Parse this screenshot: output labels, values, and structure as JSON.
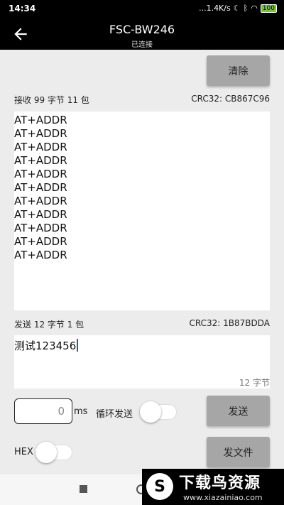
{
  "status_bar": {
    "time": "14:34",
    "network": "...1.4K/s",
    "battery": "100"
  },
  "app_bar": {
    "title": "FSC-BW246",
    "subtitle": "已连接"
  },
  "receive": {
    "summary": "接收 99 字节 11 包",
    "crc": "CRC32: CB867C96",
    "lines": [
      "AT+ADDR",
      "AT+ADDR",
      "AT+ADDR",
      "AT+ADDR",
      "AT+ADDR",
      "AT+ADDR",
      "AT+ADDR",
      "AT+ADDR",
      "AT+ADDR",
      "AT+ADDR",
      "AT+ADDR"
    ]
  },
  "clear_label": "清除",
  "send": {
    "summary": "发送 12 字节 1 包",
    "crc": "CRC32: 1B87BDDA",
    "text": "测试123456",
    "byte_count": "12 字节"
  },
  "interval": {
    "value": "0",
    "unit": "ms"
  },
  "loop_send_label": "循环发送",
  "send_label": "发送",
  "hex_label": "HEX",
  "send_file_label": "发文件",
  "watermark": {
    "logo": "S",
    "title": "下载鸟资源",
    "url": "www.xiazainiao.com"
  }
}
